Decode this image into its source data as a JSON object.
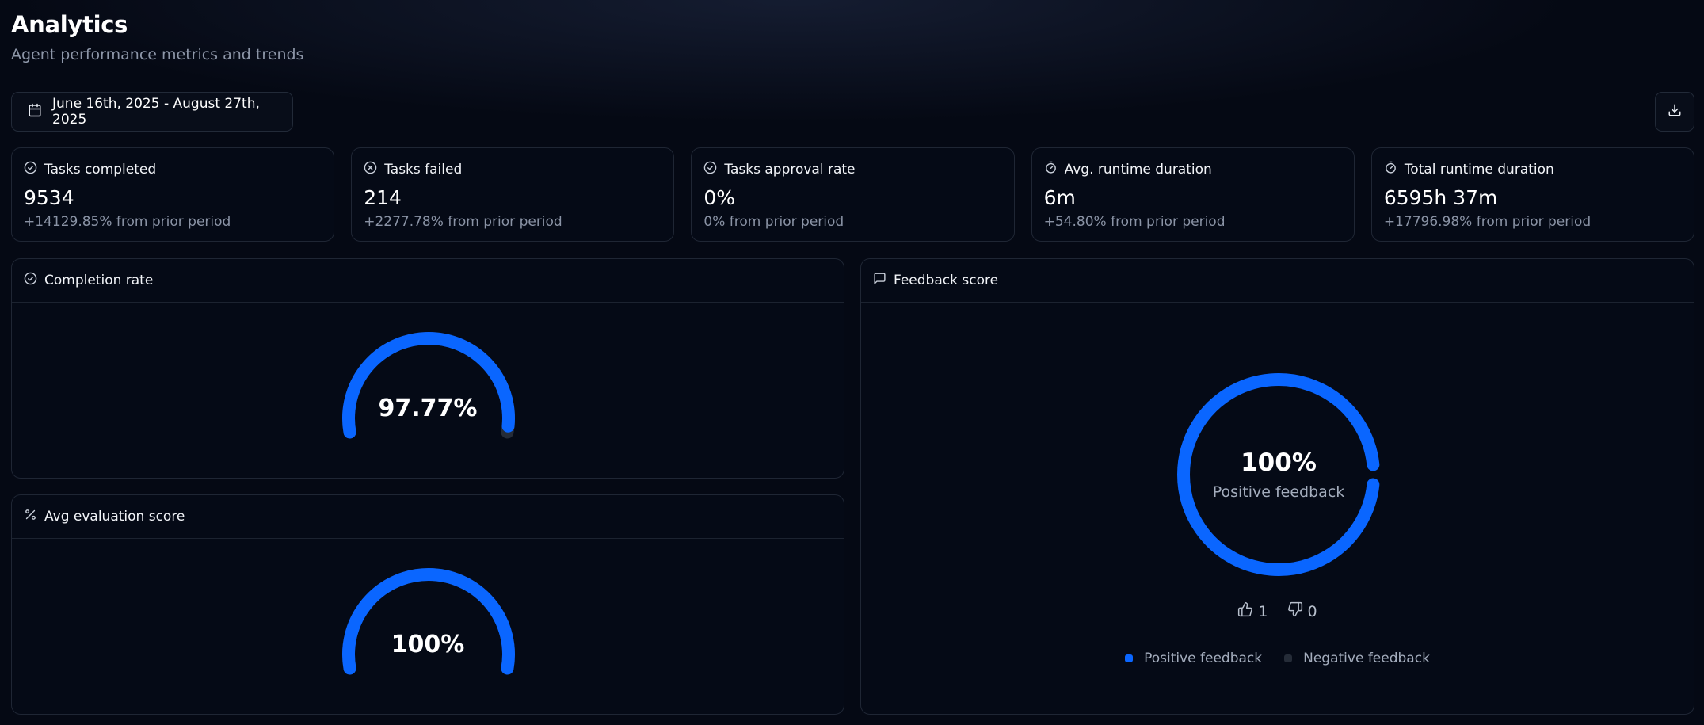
{
  "header": {
    "title": "Analytics",
    "subtitle": "Agent performance metrics and trends"
  },
  "toolbar": {
    "date_range": "June 16th, 2025 - August 27th, 2025",
    "download_icon": "download-icon"
  },
  "stats": [
    {
      "label": "Tasks completed",
      "value": "9534",
      "delta": "+14129.85% from prior period",
      "icon": "check-circle-icon"
    },
    {
      "label": "Tasks failed",
      "value": "214",
      "delta": "+2277.78% from prior period",
      "icon": "x-circle-icon"
    },
    {
      "label": "Tasks approval rate",
      "value": "0%",
      "delta": "0% from prior period",
      "icon": "check-circle-icon"
    },
    {
      "label": "Avg. runtime duration",
      "value": "6m",
      "delta": "+54.80% from prior period",
      "icon": "timer-icon"
    },
    {
      "label": "Total runtime duration",
      "value": "6595h 37m",
      "delta": "+17796.98% from prior period",
      "icon": "timer-icon"
    }
  ],
  "completion": {
    "title": "Completion rate",
    "value_text": "97.77%",
    "fraction": 0.9777
  },
  "evaluation": {
    "title": "Avg evaluation score",
    "value_text": "100%",
    "fraction": 1.0
  },
  "feedback": {
    "title": "Feedback score",
    "value_text": "100%",
    "label": "Positive feedback",
    "positive_fraction": 1.0,
    "thumbs_up": "1",
    "thumbs_down": "0",
    "legend": {
      "positive": "Positive feedback",
      "negative": "Negative feedback"
    }
  },
  "colors": {
    "accent": "#0a66ff",
    "track": "#252c38",
    "background": "#050914"
  }
}
